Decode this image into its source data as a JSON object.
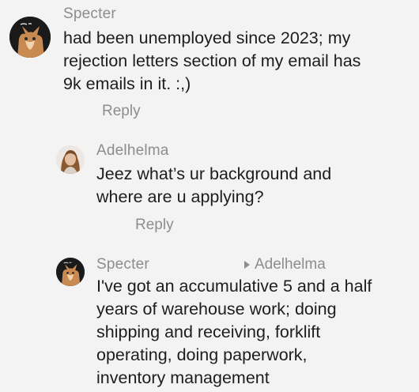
{
  "comments": [
    {
      "author": "Specter",
      "text": "had been unemployed since 2023; my\nrejection letters section of my email has\n9k emails in it. :,)",
      "reply_label": "Reply",
      "avatar_icon": "cat-avatar-icon"
    },
    {
      "author": "Adelhelma",
      "text": "Jeez what’s ur background and\nwhere are u applying?",
      "reply_label": "Reply",
      "avatar_icon": "woman-avatar-icon"
    },
    {
      "author": "Specter",
      "reply_to": "Adelhelma",
      "text": "I've got an accumulative 5 and a half\nyears of warehouse work; doing\nshipping and receiving, forklift\noperating, doing paperwork,\ninventory management",
      "avatar_icon": "cat-avatar-icon"
    }
  ],
  "colors": {
    "background": "#f3f3f3",
    "meta_text": "#8d8d8d",
    "body_text": "#1d1d1d"
  }
}
